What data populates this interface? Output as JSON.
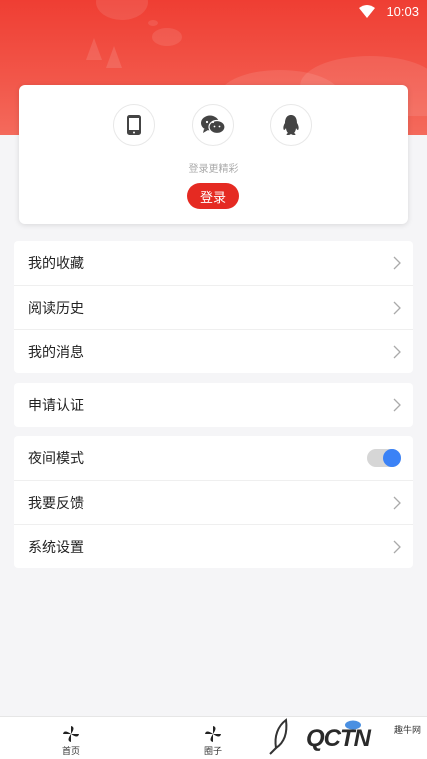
{
  "status_bar": {
    "time": "10:03"
  },
  "login_card": {
    "social_icons": [
      "phone-icon",
      "wechat-icon",
      "qq-icon"
    ],
    "hint": "登录更精彩",
    "login_label": "登录"
  },
  "menu_group_1": [
    {
      "label": "我的收藏"
    },
    {
      "label": "阅读历史"
    },
    {
      "label": "我的消息"
    }
  ],
  "menu_group_2": [
    {
      "label": "申请认证"
    }
  ],
  "menu_group_3": [
    {
      "label": "夜间模式",
      "toggle": true
    },
    {
      "label": "我要反馈"
    },
    {
      "label": "系统设置"
    }
  ],
  "tabbar": [
    {
      "label": "首页",
      "icon": "pinwheel-icon"
    },
    {
      "label": "圈子",
      "icon": "pinwheel-icon"
    }
  ],
  "watermark": {
    "text": "QCTN",
    "small": "趣牛网"
  },
  "colors": {
    "header_red": "#ef3e33",
    "login_button": "#e52a22",
    "toggle_knob": "#3b82f6",
    "page_bg": "#f5f5f7"
  }
}
